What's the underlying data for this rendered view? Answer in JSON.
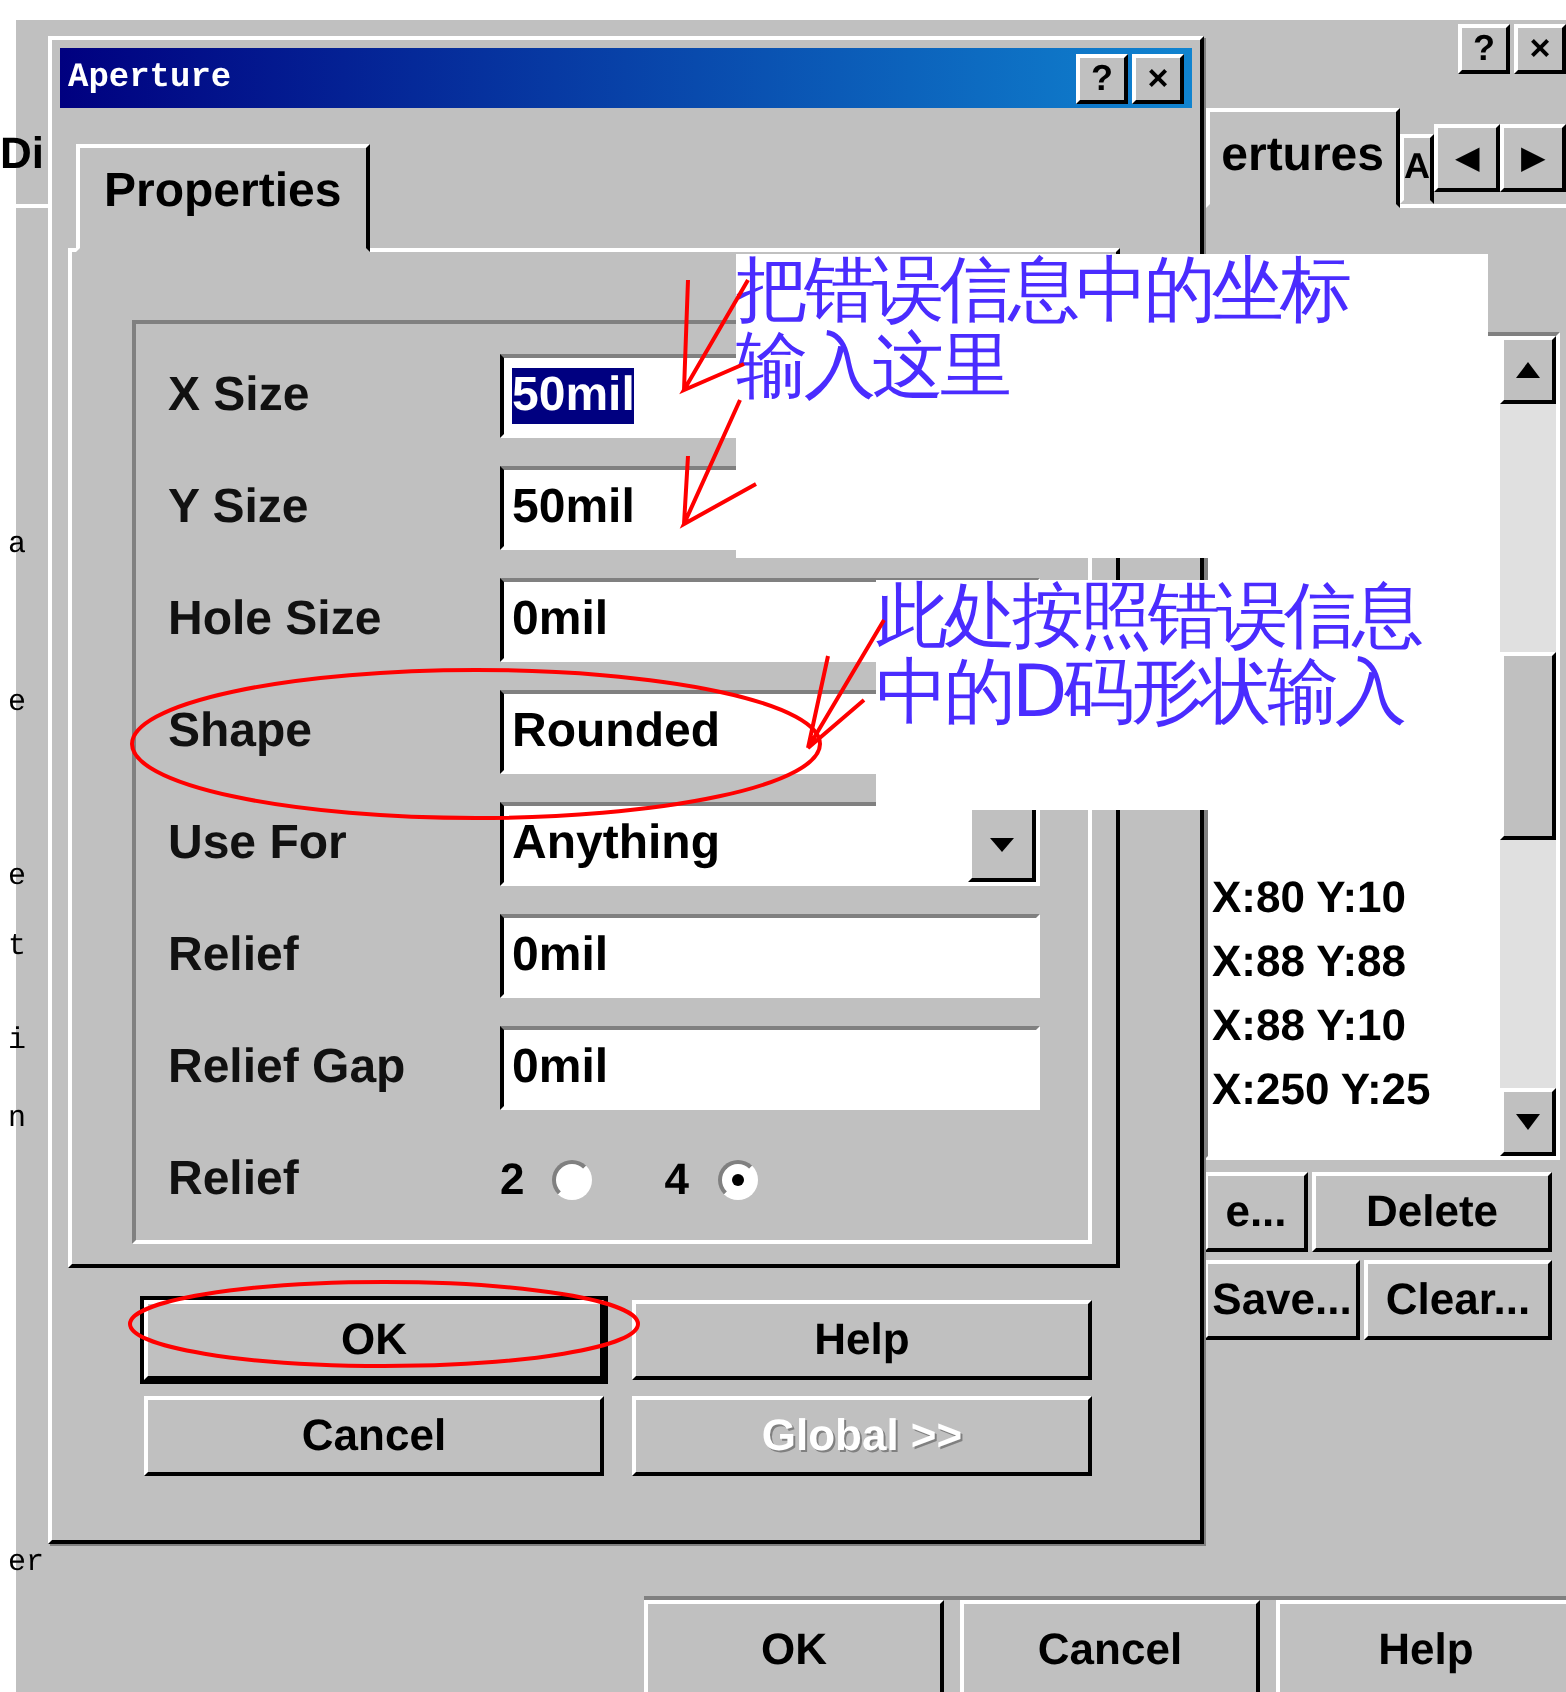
{
  "background_window": {
    "title_buttons": [
      "?",
      "×"
    ],
    "left_tab_fragment": "Di",
    "tabs": [
      {
        "label": "ertures",
        "selected": true
      },
      {
        "label": "A",
        "selected": false
      }
    ],
    "tab_scroll": [
      "◀",
      "▶"
    ],
    "left_fragments": [
      "a",
      "e",
      "e",
      "t",
      "i",
      "n",
      "er"
    ],
    "list_items": [
      "X:80 Y:10",
      "X:88 Y:88",
      "X:88 Y:10",
      "X:250 Y:25"
    ],
    "buttons": [
      {
        "label": "e...",
        "disabled": false
      },
      {
        "label": "Delete",
        "disabled": false
      },
      {
        "label": "Save...",
        "disabled": false
      },
      {
        "label": "Clear...",
        "disabled": false
      }
    ],
    "footer_buttons": [
      "OK",
      "Cancel",
      "Help"
    ]
  },
  "dialog": {
    "title": "Aperture",
    "title_buttons": [
      "?",
      "×"
    ],
    "tabs": [
      {
        "label": "Properties",
        "selected": true
      }
    ],
    "fields": [
      {
        "kind": "text",
        "label": "X Size",
        "value": "50mil",
        "selected": true
      },
      {
        "kind": "text",
        "label": "Y Size",
        "value": "50mil",
        "selected": false
      },
      {
        "kind": "text",
        "label": "Hole Size",
        "value": "0mil",
        "selected": false
      },
      {
        "kind": "text",
        "label": "Shape",
        "value": "Rounded",
        "selected": false
      },
      {
        "kind": "dropdown",
        "label": "Use For",
        "value": "Anything",
        "selected": false
      },
      {
        "kind": "text",
        "label": "Relief",
        "value": "0mil",
        "selected": false
      },
      {
        "kind": "text",
        "label": "Relief Gap",
        "value": "0mil",
        "selected": false
      }
    ],
    "relief": {
      "label": "Relief",
      "options": [
        {
          "label": "2",
          "selected": false
        },
        {
          "label": "4",
          "selected": true
        }
      ]
    },
    "buttons": [
      {
        "label": "OK",
        "disabled": false,
        "default": true
      },
      {
        "label": "Help",
        "disabled": false,
        "default": false
      },
      {
        "label": "Cancel",
        "disabled": false,
        "default": false
      },
      {
        "label": "Global >>",
        "disabled": true,
        "default": false
      }
    ]
  },
  "annotations": [
    {
      "lines": [
        "把错误信息中的坐标",
        "输入这里"
      ]
    },
    {
      "lines": [
        "此处按照错误信息",
        "中的D码形状输入"
      ]
    }
  ]
}
